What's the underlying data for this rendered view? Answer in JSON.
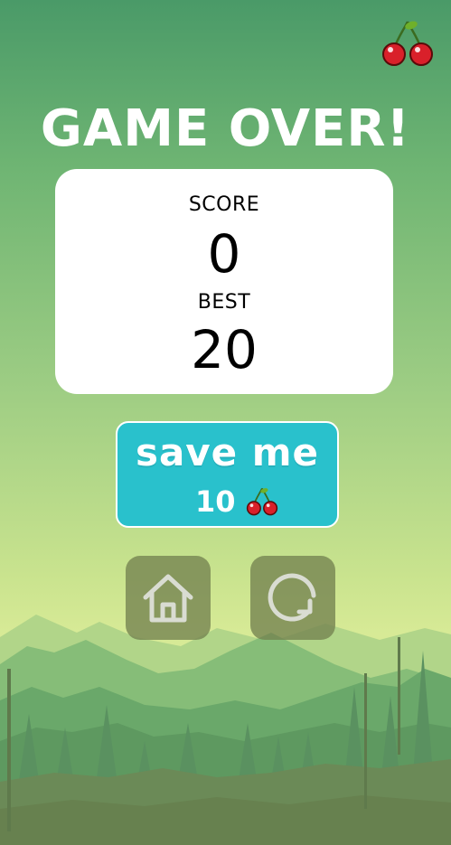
{
  "title": "GAME OVER!",
  "score": {
    "label": "SCORE",
    "value": "0"
  },
  "best": {
    "label": "BEST",
    "value": "20"
  },
  "save_me": {
    "label": "save me",
    "cost": "10",
    "currency_icon": "cherry-icon"
  },
  "buttons": {
    "home_icon": "home-icon",
    "restart_icon": "restart-icon"
  },
  "colors": {
    "save_button": "#29c1cc",
    "card": "#ffffff",
    "title": "#ffffff",
    "cherry": "#d9202a"
  }
}
